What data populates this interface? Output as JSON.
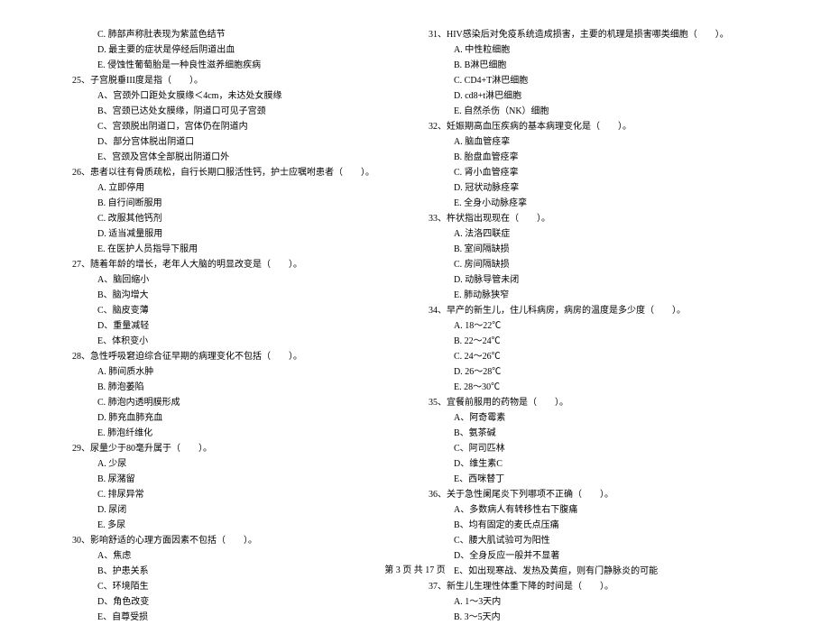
{
  "left": {
    "pre_options": [
      "C. 肺部声称肚表现为紫蓝色结节",
      "D. 最主要的症状是停经后阴道出血",
      "E. 侵蚀性葡萄胎是一种良性滋养细胞疾病"
    ],
    "q25": {
      "stem": "25、子宫脱垂III度是指（　　）。",
      "opts": [
        "A、宫颈外口距处女膜缘＜4cm，未达处女膜缘",
        "B、宫颈已达处女膜缘，阴道口可见子宫颈",
        "C、宫颈脱出阴道口，宫体仍在阴道内",
        "D、部分宫体脱出阴道口",
        "E、宫颈及宫体全部脱出阴道口外"
      ]
    },
    "q26": {
      "stem": "26、患者以往有骨质疏松，自行长期口服活性钙，护士应嘱咐患者（　　）。",
      "opts": [
        "A. 立即停用",
        "B. 自行间断服用",
        "C. 改服其他钙剂",
        "D. 适当减量服用",
        "E. 在医护人员指导下服用"
      ]
    },
    "q27": {
      "stem": "27、随着年龄的增长，老年人大脑的明显改变是（　　）。",
      "opts": [
        "A、脑回缩小",
        "B、脑沟增大",
        "C、脑皮变薄",
        "D、重量减轻",
        "E、体积变小"
      ]
    },
    "q28": {
      "stem": "28、急性呼吸窘迫综合征早期的病理变化不包括（　　）。",
      "opts": [
        "A. 肺间质水肿",
        "B. 肺泡萎陷",
        "C. 肺泡内透明膜形成",
        "D. 肺充血肺充血",
        "E. 肺泡纤维化"
      ]
    },
    "q29": {
      "stem": "29、尿量少于80毫升属于（　　）。",
      "opts": [
        "A. 少尿",
        "B. 尿潴留",
        "C. 排尿异常",
        "D. 尿闭",
        "E. 多尿"
      ]
    },
    "q30": {
      "stem": "30、影响舒适的心理方面因素不包括（　　）。",
      "opts": [
        "A、焦虑",
        "B、护患关系",
        "C、环境陌生",
        "D、角色改变",
        "E、自尊受损"
      ]
    }
  },
  "right": {
    "q31": {
      "stem": "31、HIV感染后对免疫系统造成损害，主要的机理是损害哪类细胞（　　）。",
      "opts": [
        "A. 中性粒细胞",
        "B. B淋巴细胞",
        "C. CD4+T淋巴细胞",
        "D. cd8+t淋巴细胞",
        "E. 自然杀伤（NK）细胞"
      ]
    },
    "q32": {
      "stem": "32、妊娠期高血压疾病的基本病理变化是（　　）。",
      "opts": [
        "A. 脑血管痉挛",
        "B. 胎盘血管痉挛",
        "C. 肾小血管痉挛",
        "D. 冠状动脉痉挛",
        "E. 全身小动脉痉挛"
      ]
    },
    "q33": {
      "stem": "33、杵状指出现现在（　　）。",
      "opts": [
        "A. 法洛四联症",
        "B. 室间隔缺损",
        "C. 房间隔缺损",
        "D. 动脉导管未闭",
        "E. 肺动脉狭窄"
      ]
    },
    "q34": {
      "stem": "34、早产的新生儿，住儿科病房，病房的温度是多少度（　　）。",
      "opts": [
        "A. 18～22℃",
        "B. 22～24℃",
        "C. 24～26℃",
        "D. 26～28℃",
        "E. 28～30℃"
      ]
    },
    "q35": {
      "stem": "35、宜餐前服用的药物是（　　）。",
      "opts": [
        "A、阿奇霉素",
        "B、氨茶碱",
        "C、阿司匹林",
        "D、维生素C",
        "E、西咪替丁"
      ]
    },
    "q36": {
      "stem": "36、关于急性阑尾炎下列哪项不正确（　　）。",
      "opts": [
        "A、多数病人有转移性右下腹痛",
        "B、均有固定的麦氏点压痛",
        "C、腰大肌试验可为阳性",
        "D、全身反应一般并不显著",
        "E、如出现寒战、发热及黄疸，则有门静脉炎的可能"
      ]
    },
    "q37": {
      "stem": "37、新生儿生理性体重下降的时间是（　　）。",
      "opts": [
        "A. 1～3天内",
        "B. 3～5天内"
      ]
    }
  },
  "footer": "第 3 页 共 17 页"
}
